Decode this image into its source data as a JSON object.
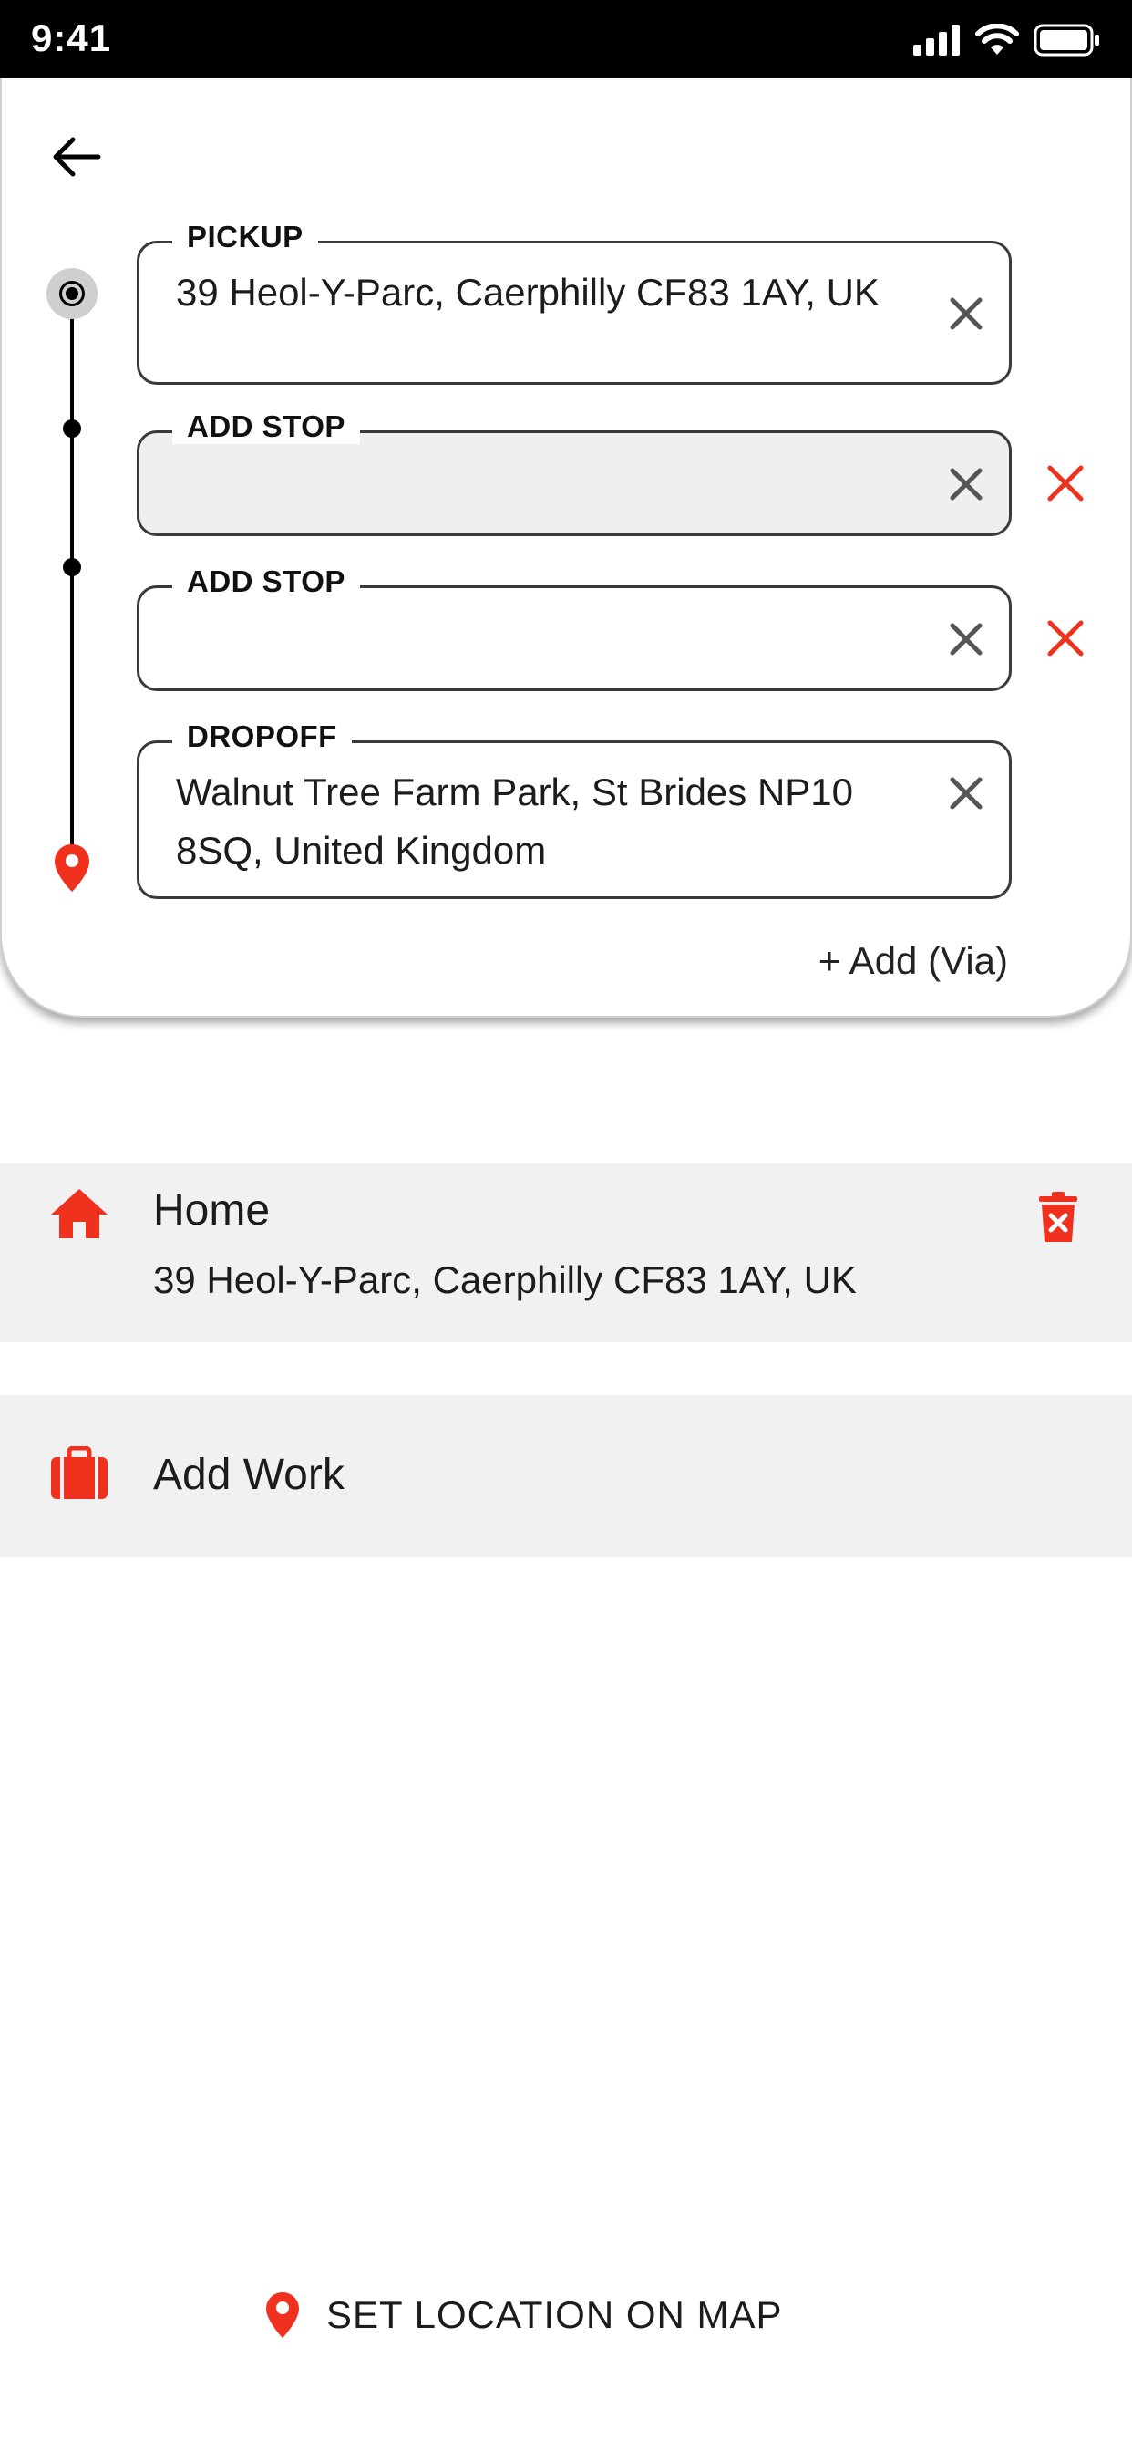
{
  "status_bar": {
    "time": "9:41"
  },
  "route": {
    "pickup": {
      "label": "PICKUP",
      "value": "39 Heol-Y-Parc, Caerphilly CF83 1AY, UK"
    },
    "stops": [
      {
        "label": "ADD STOP",
        "value": ""
      },
      {
        "label": "ADD STOP",
        "value": ""
      }
    ],
    "dropoff": {
      "label": "DROPOFF",
      "value": "Walnut Tree Farm Park, St Brides NP10 8SQ, United Kingdom"
    },
    "add_via_label": "+ Add (Via)"
  },
  "saved_places": {
    "home": {
      "title": "Home",
      "address": "39 Heol-Y-Parc, Caerphilly CF83 1AY, UK"
    },
    "work": {
      "title": "Add Work"
    }
  },
  "map_link": {
    "label": "SET LOCATION ON MAP"
  },
  "colors": {
    "accent": "#f0311d",
    "field_border": "#3a3a3a",
    "row_bg": "#f1f1f1"
  }
}
